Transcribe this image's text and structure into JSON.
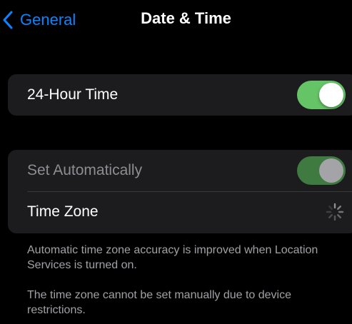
{
  "nav": {
    "back_label": "General",
    "title": "Date & Time",
    "back_icon": "chevron-left-icon"
  },
  "group1": {
    "row_24h": {
      "label": "24-Hour Time",
      "toggle_on": true
    }
  },
  "group2": {
    "row_auto": {
      "label": "Set Automatically",
      "toggle_on": true,
      "disabled": true
    },
    "row_tz": {
      "label": "Time Zone",
      "status_icon": "loading-spinner-icon"
    }
  },
  "footnotes": {
    "accuracy": "Automatic time zone accuracy is improved when Location Services is turned on.",
    "restriction": "The time zone cannot be set manually due to device restrictions."
  },
  "colors": {
    "accent": "#0a84ff",
    "toggle_on": "#65c466",
    "toggle_disabled": "#3f7a41",
    "cell_background": "#1c1c1e",
    "page_background": "#000000"
  }
}
